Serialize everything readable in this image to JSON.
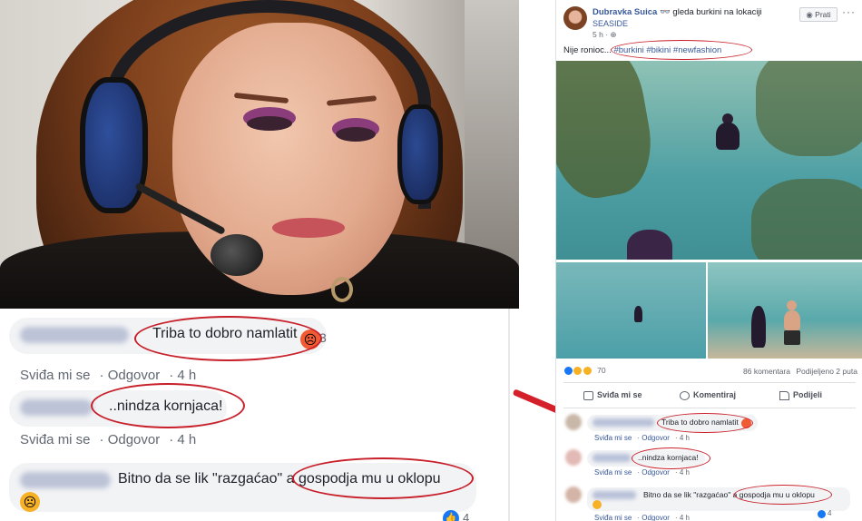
{
  "zoomed_comments": [
    {
      "text": "Triba to dobro namlatit",
      "count": "3",
      "like": "Sviđa mi se",
      "reply": "Odgovor",
      "time": "4 h",
      "reaction_icon": "angry-face-icon"
    },
    {
      "text": "..nindza kornjaca!",
      "like": "Sviđa mi se",
      "reply": "Odgovor",
      "time": "4 h"
    },
    {
      "text": "Bitno da se lik \"razgaćao\" a gospodja mu u oklopu",
      "count": "4",
      "reaction_icon": "sad-face-icon"
    }
  ],
  "post": {
    "author": "Dubravka Suica",
    "activity": "gleda burkini na lokaciji",
    "location": "SEASIDE",
    "time": "5 h",
    "follow_label": "Prati",
    "more_label": "···",
    "text_prefix": "Nije ronioc...",
    "hashtags": "#burkini #bikini #newfashion",
    "reaction_count": "70",
    "comments_count": "86 komentara",
    "shares_count": "Podijeljeno 2 puta",
    "actions": {
      "like": "Sviđa mi se",
      "comment": "Komentiraj",
      "share": "Podijeli"
    }
  },
  "post_comments": [
    {
      "text": "Triba to dobro namlatit",
      "like": "Sviđa mi se",
      "reply": "Odgovor",
      "time": "4 h"
    },
    {
      "text": "..nindza kornjaca!",
      "like": "Sviđa mi se",
      "reply": "Odgovor",
      "time": "4 h"
    },
    {
      "text": "Bitno da se lik \"razgaćao\" a gospodja mu u oklopu",
      "like": "Sviđa mi se",
      "reply": "Odgovor",
      "time": "4 h",
      "count": "4"
    }
  ],
  "colors": {
    "highlight": "#c8202a",
    "fb_link": "#385898",
    "arrow": "#d4202a"
  }
}
